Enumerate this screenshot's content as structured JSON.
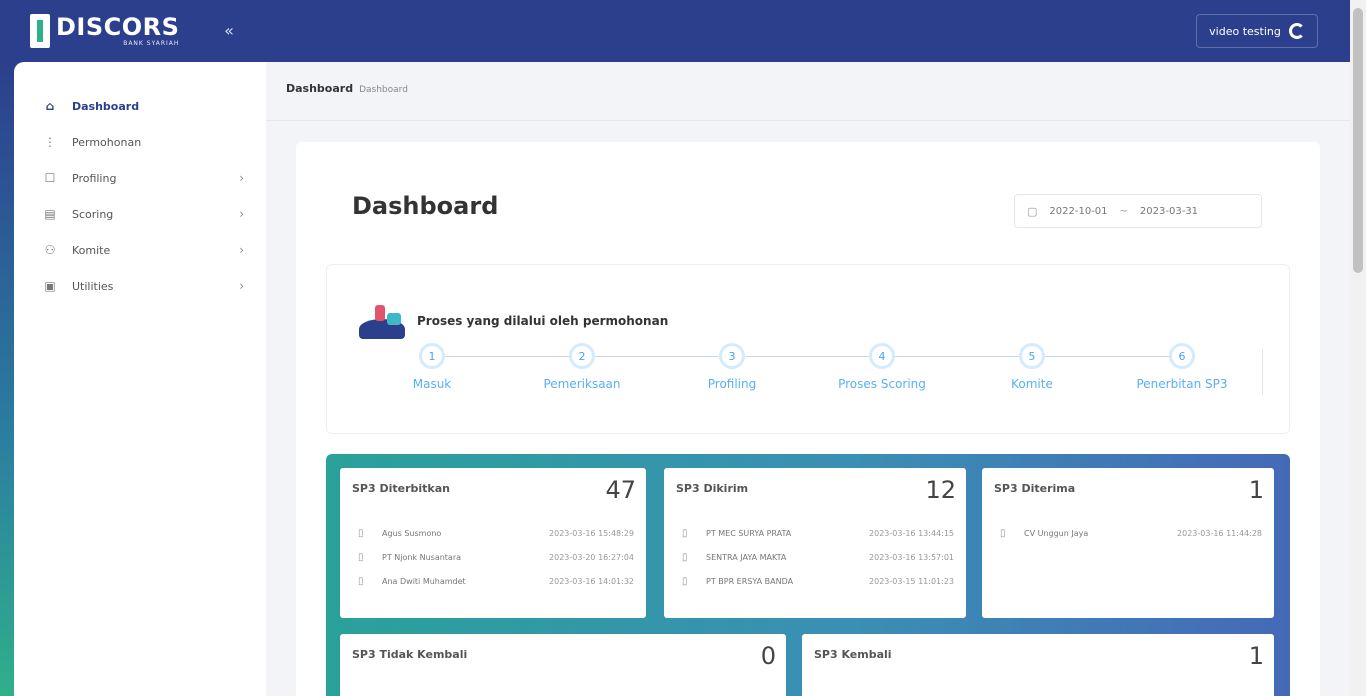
{
  "header": {
    "logo_title": "DISCORS",
    "logo_sub": "BANK SYARIAH",
    "collapse_icon": "«",
    "user_name": "video testing"
  },
  "sidebar": {
    "items": [
      {
        "label": "Dashboard",
        "icon": "home-icon",
        "glyph": "⌂",
        "active": true,
        "chevron": false
      },
      {
        "label": "Permohonan",
        "icon": "doc-icon",
        "glyph": "⋮",
        "active": false,
        "chevron": false
      },
      {
        "label": "Profiling",
        "icon": "profile-icon",
        "glyph": "☐",
        "active": false,
        "chevron": true
      },
      {
        "label": "Scoring",
        "icon": "chart-icon",
        "glyph": "▤",
        "active": false,
        "chevron": true
      },
      {
        "label": "Komite",
        "icon": "user-icon",
        "glyph": "⚇",
        "active": false,
        "chevron": true
      },
      {
        "label": "Utilities",
        "icon": "tools-icon",
        "glyph": "▣",
        "active": false,
        "chevron": true
      }
    ]
  },
  "breadcrumb": {
    "current": "Dashboard",
    "sub": "Dashboard"
  },
  "page": {
    "title": "Dashboard",
    "date_start": "2022-10-01",
    "date_sep": "~",
    "date_end": "2023-03-31"
  },
  "process": {
    "title": "Proses yang dilalui oleh permohonan",
    "steps": [
      {
        "num": "1",
        "label": "Masuk"
      },
      {
        "num": "2",
        "label": "Pemeriksaan"
      },
      {
        "num": "3",
        "label": "Profiling"
      },
      {
        "num": "4",
        "label": "Proses Scoring"
      },
      {
        "num": "5",
        "label": "Komite"
      },
      {
        "num": "6",
        "label": "Penerbitan SP3"
      }
    ]
  },
  "stats": {
    "diterbitkan": {
      "title": "SP3 Diterbitkan",
      "count": "47",
      "rows": [
        {
          "name": "Agus Susmono",
          "date": "2023-03-16 15:48:29"
        },
        {
          "name": "PT Njonk Nusantara",
          "date": "2023-03-20 16:27:04"
        },
        {
          "name": "Ana Dwiti Muhamdet",
          "date": "2023-03-16 14:01:32"
        }
      ]
    },
    "dikirim": {
      "title": "SP3 Dikirim",
      "count": "12",
      "rows": [
        {
          "name": "PT MEC SURYA PRATA",
          "date": "2023-03-16 13:44:15"
        },
        {
          "name": "SENTRA JAYA MAKTA",
          "date": "2023-03-16 13:57:01"
        },
        {
          "name": "PT BPR ERSYA BANDA",
          "date": "2023-03-15 11:01:23"
        }
      ]
    },
    "diterima": {
      "title": "SP3 Diterima",
      "count": "1",
      "rows": [
        {
          "name": "CV Unggun Jaya",
          "date": "2023-03-16 11:44:28"
        }
      ]
    },
    "tidak_kembali": {
      "title": "SP3 Tidak Kembali",
      "count": "0"
    },
    "kembali": {
      "title": "SP3 Kembali",
      "count": "1"
    }
  },
  "colors": {
    "brand": "#2c3f8c",
    "step": "#5aaef7",
    "gradient_start": "#2aa19a",
    "gradient_end": "#4569b8"
  }
}
